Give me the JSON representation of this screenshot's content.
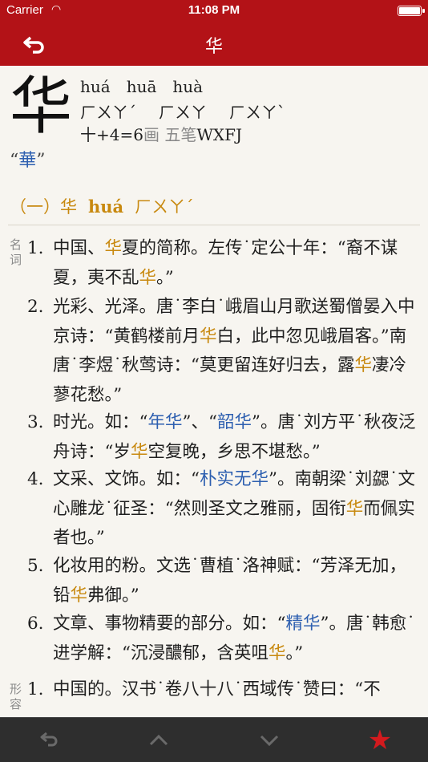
{
  "status": {
    "carrier": "Carrier",
    "wifi_icon": "wifi-icon",
    "time": "11:08 PM"
  },
  "nav": {
    "back_glyph": "⮌",
    "title": "华"
  },
  "entry": {
    "char": "华",
    "pinyin": [
      "huá",
      "huā",
      "huà"
    ],
    "zhuyin": [
      "ㄏㄨㄚˊ",
      "ㄏㄨㄚ",
      "ㄏㄨㄚˋ"
    ],
    "stroke_radical": "十",
    "stroke_plus": "+4=6",
    "stroke_unit": "画",
    "wubi_label": "五笔",
    "wubi_code": "WXFJ",
    "trad_open": "“",
    "trad": "華",
    "trad_close": "”"
  },
  "section": {
    "index": "（一）华",
    "pinyin": "huá",
    "zhuyin": "ㄏㄨㄚˊ"
  },
  "pos_noun": "名词",
  "pos_adj": "形容",
  "definitions": [
    {
      "num": "1.",
      "a": "中国、",
      "h": "华",
      "b": "夏的简称。左传˙定公十年：“裔不谋夏，夷不乱",
      "h2": "华",
      "c": "。”"
    },
    {
      "num": "2.",
      "a": "光彩、光泽。唐˙李白˙峨眉山月歌送蜀僧晏入中京诗：“黄鹤楼前月",
      "h": "华",
      "b": "白，此中忽见峨眉客。”南唐˙李煜˙秋莺诗：“莫更留连好归去，露",
      "h2": "华",
      "c": "凄冷蓼花愁。”"
    },
    {
      "num": "3.",
      "a": "时光。如：“",
      "k1": "年华",
      "m": "”、“",
      "k2": "韶华",
      "b": "”。唐˙刘方平˙秋夜泛舟诗：“岁",
      "h": "华",
      "c": "空复晚，乡思不堪愁。”"
    },
    {
      "num": "4.",
      "a": "文采、文饰。如：“",
      "k1": "朴实无华",
      "b": "”。南朝梁˙刘勰˙文心雕龙˙征圣：“然则圣文之雅丽，固衔",
      "h": "华",
      "c": "而佩实者也。”"
    },
    {
      "num": "5.",
      "a": "化妆用的粉。文选˙曹植˙洛神赋：“芳泽无加，铅",
      "h": "华",
      "c": "弗御。”"
    },
    {
      "num": "6.",
      "a": "文章、事物精要的部分。如：“",
      "k1": "精华",
      "b": "”。唐˙韩愈˙进学解：“沉浸醲郁，含英咀",
      "h": "华",
      "c": "。”"
    },
    {
      "num": "1.",
      "a": "中国的。汉书˙卷八十八˙西域传˙赞曰：“不",
      "h": "",
      "c": ""
    }
  ],
  "toolbar": {
    "back_icon": "back-icon",
    "up_icon": "chevron-up-icon",
    "down_icon": "chevron-down-icon",
    "star_icon": "star-icon"
  }
}
